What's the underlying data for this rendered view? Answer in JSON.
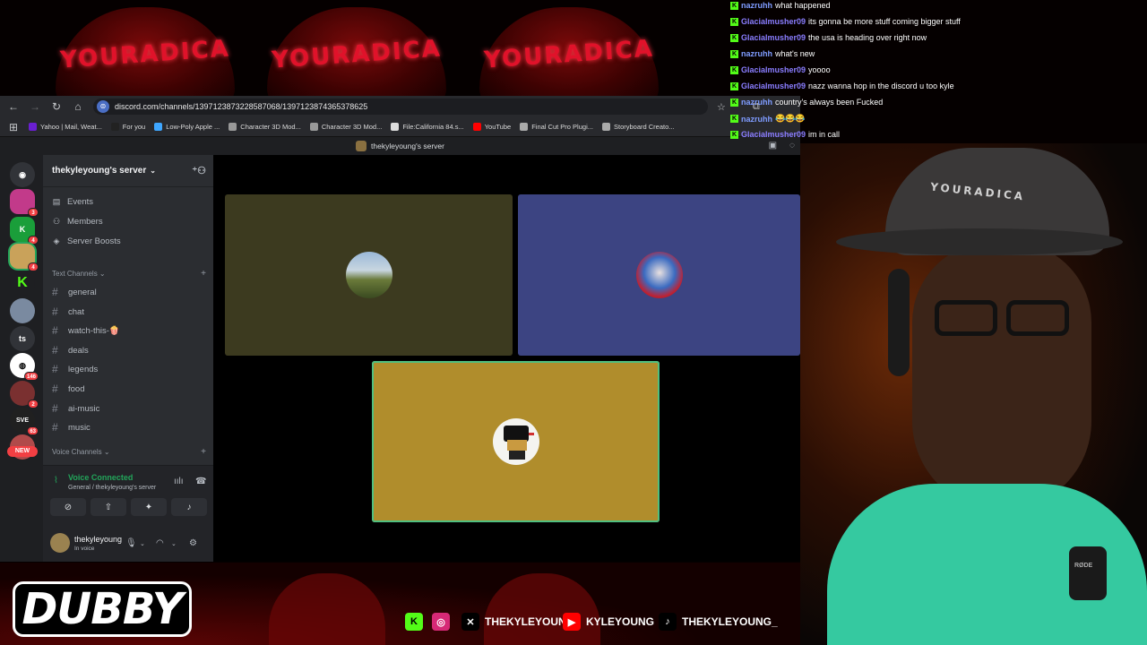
{
  "browser": {
    "url": "discord.com/channels/1397123873228587068/1397123874365378625",
    "bookmarks": [
      {
        "label": "Yahoo | Mail, Weat...",
        "color": "#6a1fd1"
      },
      {
        "label": "For you",
        "color": "#222222"
      },
      {
        "label": "Low-Poly Apple ...",
        "color": "#3ea6ff"
      },
      {
        "label": "Character 3D Mod...",
        "color": "#999999"
      },
      {
        "label": "Character 3D Mod...",
        "color": "#999999"
      },
      {
        "label": "File:California 84.s...",
        "color": "#dddddd"
      },
      {
        "label": "YouTube",
        "color": "#ff0000"
      },
      {
        "label": "Final Cut Pro Plugi...",
        "color": "#aaaaaa"
      },
      {
        "label": "Storyboard Creato...",
        "color": "#aaaaaa"
      }
    ]
  },
  "discord": {
    "topbar_title": "thekyleyoung's server",
    "server_name": "thekyleyoung's server",
    "nav": [
      {
        "label": "Events",
        "icon": "calendar-icon"
      },
      {
        "label": "Members",
        "icon": "members-icon"
      },
      {
        "label": "Server Boosts",
        "icon": "boost-icon"
      }
    ],
    "text_category": "Text Channels",
    "channels": [
      "general",
      "chat",
      "watch-this-🍿",
      "deals",
      "legends",
      "food",
      "ai-music",
      "music"
    ],
    "voice_category": "Voice Channels",
    "rail_badges": [
      "3",
      "4",
      "4",
      "146",
      "2",
      "63"
    ],
    "rail_ts": "ts",
    "new_label": "NEW",
    "voice": {
      "status": "Voice Connected",
      "location": "General / thekyleyoung's server"
    },
    "user": {
      "name": "thekyleyoung",
      "status": "In voice"
    },
    "tiles": [
      {
        "color": "#3c3a1f"
      },
      {
        "color": "#3c4482"
      },
      {
        "color": "#b08d2c",
        "speaking_border": "#4fbf80"
      }
    ]
  },
  "chat": [
    {
      "user": "nazruhh",
      "color": "#7f9cff",
      "text": "what happened"
    },
    {
      "user": "Glacialmusher09",
      "color": "#8a7dff",
      "text": "its gonna be more stuff coming bigger stuff"
    },
    {
      "user": "Glacialmusher09",
      "color": "#8a7dff",
      "text": "the usa is heading over right now"
    },
    {
      "user": "nazruhh",
      "color": "#7f9cff",
      "text": "what's new"
    },
    {
      "user": "Glacialmusher09",
      "color": "#8a7dff",
      "text": "yoooo"
    },
    {
      "user": "Glacialmusher09",
      "color": "#8a7dff",
      "text": "nazz wanna hop in the discord u too kyle"
    },
    {
      "user": "nazruhh",
      "color": "#7f9cff",
      "text": "country's always been Fucked"
    },
    {
      "user": "nazruhh",
      "color": "#7f9cff",
      "text": "😂😂😂"
    },
    {
      "user": "Glacialmusher09",
      "color": "#8a7dff",
      "text": "im in call"
    }
  ],
  "overlay": {
    "bg_logo_text": "YOURADICA",
    "cap_text": "YOURADICA",
    "mic_text": "RØDE",
    "brand": "DUBBY",
    "socials": [
      {
        "icon": "kick-icon",
        "label": "",
        "color": "#53fc18"
      },
      {
        "icon": "instagram-icon",
        "label": "",
        "color": "#d62976"
      },
      {
        "icon": "x-icon",
        "label": "THEKYLEYOUNG",
        "color": "#000000"
      },
      {
        "icon": "youtube-icon",
        "label": "KYLEYOUNG",
        "color": "#ff0000"
      },
      {
        "icon": "tiktok-icon",
        "label": "THEKYLEYOUNG_",
        "color": "#000000"
      }
    ]
  }
}
